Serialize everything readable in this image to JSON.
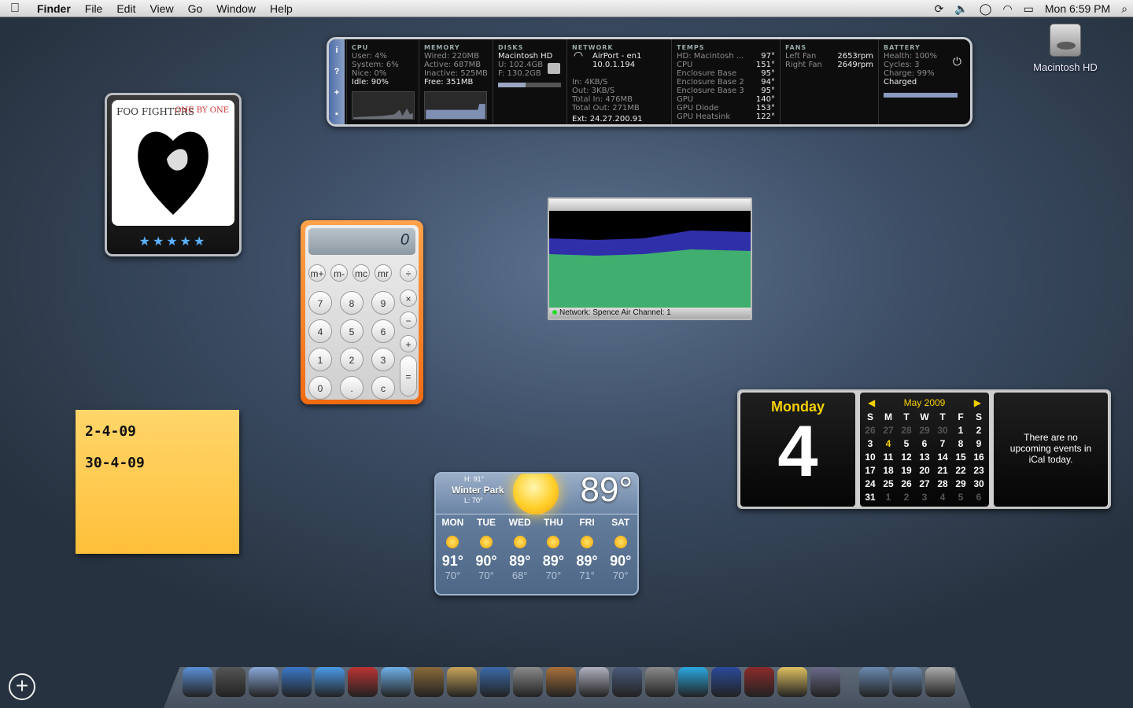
{
  "menubar": {
    "app": "Finder",
    "items": [
      "File",
      "Edit",
      "View",
      "Go",
      "Window",
      "Help"
    ],
    "clock": "Mon 6:59 PM"
  },
  "desktop": {
    "drive_label": "Macintosh HD"
  },
  "istat": {
    "cpu": {
      "title": "CPU",
      "user": "User: 4%",
      "system": "System: 6%",
      "nice": "Nice: 0%",
      "idle": "Idle: 90%"
    },
    "memory": {
      "title": "MEMORY",
      "wired": "Wired: 220MB",
      "active": "Active: 687MB",
      "inactive": "Inactive: 525MB",
      "free": "Free: 351MB"
    },
    "disks": {
      "title": "DISKS",
      "name": "Macintosh HD",
      "used": "U: 102.4GB",
      "free": "F: 130.2GB"
    },
    "network": {
      "title": "NETWORK",
      "iface": "AirPort - en1",
      "ip": "10.0.1.194",
      "in": "In: 4KB/S",
      "out": "Out: 3KB/S",
      "total_in": "Total In: 476MB",
      "total_out": "Total Out: 271MB",
      "ext": "Ext: 24.27.200.91"
    },
    "temps": {
      "title": "TEMPS",
      "rows": [
        [
          "HD: Macintosh ...",
          "97°"
        ],
        [
          "CPU",
          "151°"
        ],
        [
          "Enclosure Base",
          "95°"
        ],
        [
          "Enclosure Base 2",
          "94°"
        ],
        [
          "Enclosure Base 3",
          "95°"
        ],
        [
          "GPU",
          "140°"
        ],
        [
          "GPU Diode",
          "153°"
        ],
        [
          "GPU Heatsink",
          "122°"
        ]
      ]
    },
    "fans": {
      "title": "FANS",
      "rows": [
        [
          "Left Fan",
          "2653rpm"
        ],
        [
          "Right Fan",
          "2649rpm"
        ]
      ]
    },
    "battery": {
      "title": "BATTERY",
      "health": "Health: 100%",
      "cycles": "Cycles: 3",
      "charge": "Charge: 99%",
      "status": "Charged"
    }
  },
  "album": {
    "band": "FOO FIGHTERS",
    "title": "ONE BY ONE",
    "stars": "★★★★★"
  },
  "calculator": {
    "display": "0",
    "buttons": [
      "m+",
      "m-",
      "mc",
      "mr",
      "÷",
      "7",
      "8",
      "9",
      "×",
      "4",
      "5",
      "6",
      "−",
      "1",
      "2",
      "3",
      "+",
      "0",
      ".",
      "c",
      "="
    ]
  },
  "sticky": {
    "line1": "2-4-09",
    "line2": "30-4-09"
  },
  "network_widget": {
    "status": "Network: Spence Air Channel: 1"
  },
  "weather": {
    "city": "Winter Park",
    "hi": "H: 91°",
    "lo": "L: 70°",
    "temp": "89°",
    "days": [
      {
        "name": "MON",
        "hi": "91°",
        "lo": "70°"
      },
      {
        "name": "TUE",
        "hi": "90°",
        "lo": "70°"
      },
      {
        "name": "WED",
        "hi": "89°",
        "lo": "68°"
      },
      {
        "name": "THU",
        "hi": "89°",
        "lo": "70°"
      },
      {
        "name": "FRI",
        "hi": "89°",
        "lo": "71°"
      },
      {
        "name": "SAT",
        "hi": "90°",
        "lo": "70°"
      }
    ]
  },
  "ical": {
    "day_name": "Monday",
    "day_number": "4",
    "month": "May 2009",
    "weekdays": [
      "S",
      "M",
      "T",
      "W",
      "T",
      "F",
      "S"
    ],
    "weeks": [
      [
        "26",
        "27",
        "28",
        "29",
        "30",
        "1",
        "2"
      ],
      [
        "3",
        "4",
        "5",
        "6",
        "7",
        "8",
        "9"
      ],
      [
        "10",
        "11",
        "12",
        "13",
        "14",
        "15",
        "16"
      ],
      [
        "17",
        "18",
        "19",
        "20",
        "21",
        "22",
        "23"
      ],
      [
        "24",
        "25",
        "26",
        "27",
        "28",
        "29",
        "30"
      ],
      [
        "31",
        "1",
        "2",
        "3",
        "4",
        "5",
        "6"
      ]
    ],
    "events": "There are no upcoming events in iCal today."
  },
  "dock": {
    "icons": [
      "finder-icon",
      "dashboard-icon",
      "mail-icon",
      "safari-icon",
      "ichat-icon",
      "photo-booth-icon",
      "itunes-icon",
      "iphoto-icon",
      "preview-icon",
      "dvd-player-icon",
      "imovie-icon",
      "garageband-icon",
      "frontrow-icon",
      "spaces-icon",
      "system-preferences-icon",
      "skype-icon",
      "user-icon",
      "dictionary-icon",
      "stickies-icon",
      "script-icon",
      "applications-folder-icon",
      "documents-folder-icon",
      "trash-icon"
    ]
  }
}
